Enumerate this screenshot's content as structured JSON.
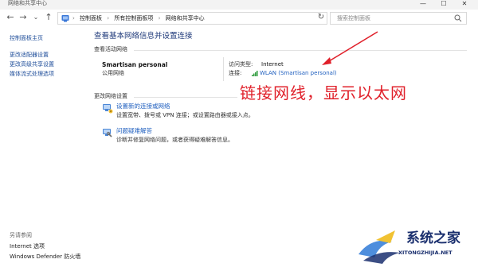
{
  "window": {
    "title": "网络和共享中心",
    "minimize": "—",
    "maximize": "☐",
    "close": "✕"
  },
  "nav": {
    "back": "←",
    "forward": "→",
    "recent": "⌄",
    "up": "↑",
    "refresh": "↻",
    "dropdown": "⌄"
  },
  "address": {
    "crumbs": [
      "控制面板",
      "所有控制面板项",
      "网络和共享中心"
    ],
    "separator": "›",
    "prefix_sep": "›"
  },
  "search": {
    "placeholder": "搜索控制面板"
  },
  "sidebar": {
    "home": "控制面板主页",
    "items": [
      "更改适配器设置",
      "更改高级共享设置",
      "媒体流式处理选项"
    ],
    "see_also_title": "另请参阅",
    "see_also": [
      "Internet 选项",
      "Windows Defender 防火墙"
    ]
  },
  "main": {
    "title": "查看基本网络信息并设置连接",
    "active_networks_label": "查看活动网络",
    "network": {
      "name": "Smartisan personal",
      "category": "公用网络",
      "access_type_label": "访问类型:",
      "access_type_value": "Internet",
      "connections_label": "连接:",
      "connections_value": "WLAN (Smartisan personal)"
    },
    "change_settings_label": "更改网络设置",
    "tasks": [
      {
        "icon": "network-setup-icon",
        "link": "设置新的连接或网络",
        "desc": "设置宽带、拨号或 VPN 连接；或设置路由器或接入点。"
      },
      {
        "icon": "troubleshoot-icon",
        "link": "问题疑难解答",
        "desc": "诊断并修复网络问题，或者获得疑难解答信息。"
      }
    ]
  },
  "annotation": {
    "text": "链接网线，显示以太网",
    "color": "#e0202a"
  },
  "watermark": {
    "title": "系统之家",
    "subtitle": "XITONGZHIJIA.NET"
  },
  "colors": {
    "link": "#1f5fbf",
    "heading": "#1f3a7a",
    "accent_red": "#e0202a"
  }
}
